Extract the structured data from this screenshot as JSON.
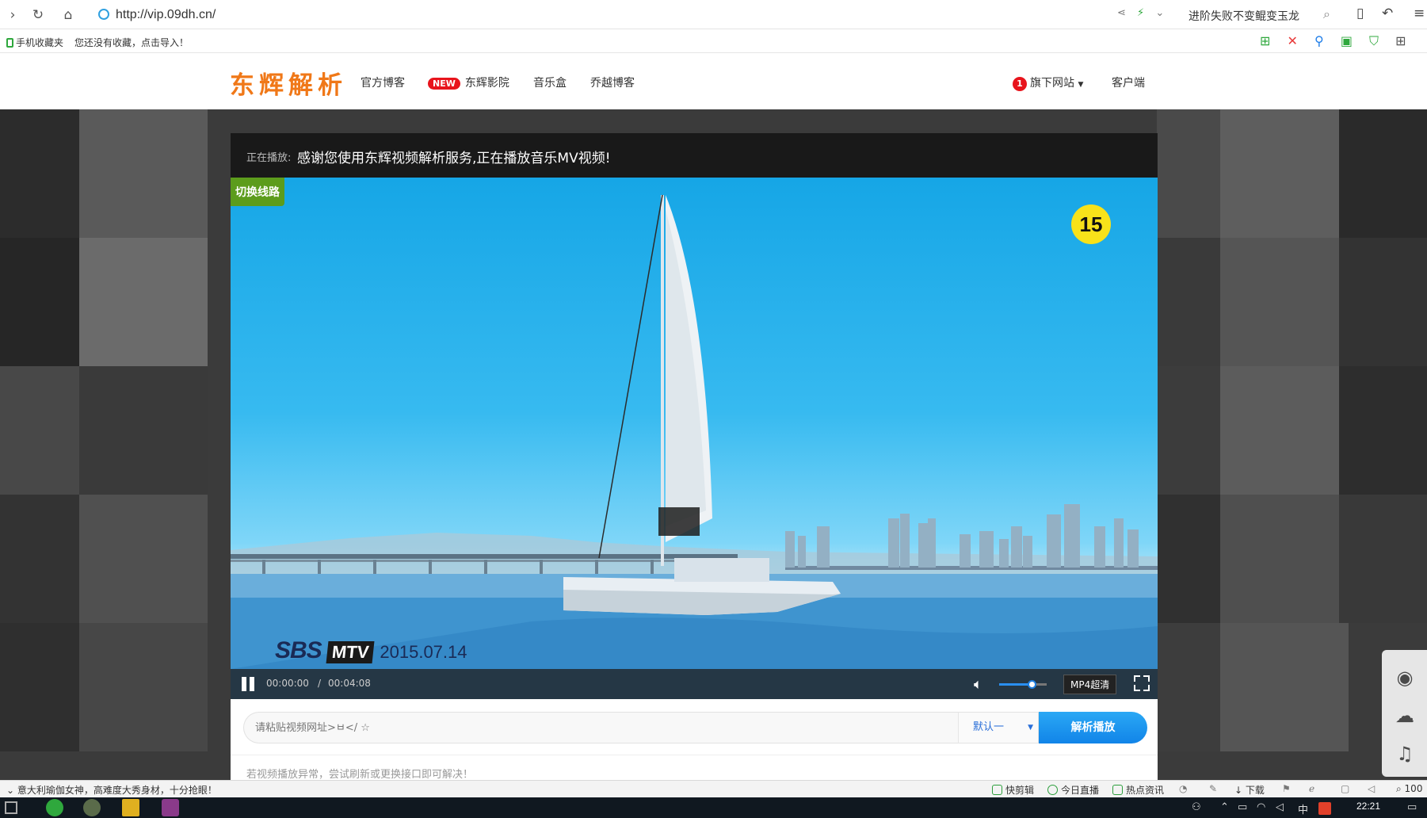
{
  "browser": {
    "url": "http://vip.09dh.cn/",
    "hot_search": "进阶失败不变鲲变玉龙",
    "favorites": {
      "mobile_fav": "手机收藏夹",
      "import_hint": "您还没有收藏，点击导入！"
    }
  },
  "site": {
    "logo": "东辉解析",
    "nav": {
      "blog": "官方博客",
      "new_badge": "NEW",
      "cinema": "东辉影院",
      "music_box": "音乐盒",
      "qiaoyue_blog": "乔越博客",
      "sites_badge": "1",
      "sites": "旗下网站",
      "client": "客户端"
    }
  },
  "player": {
    "now_playing_label": "正在播放:",
    "now_playing_text": "感谢您使用东辉视频解析服务,正在播放音乐MV视频!",
    "switch_line": "切换线路",
    "rating": "15",
    "watermark": {
      "sbs": "SBS",
      "mtv": "MTV",
      "date": "2015.07.14"
    },
    "time_current": "00:00:00",
    "time_separator": "/",
    "time_total": "00:04:08",
    "volume": 0.7,
    "quality": "MP4超清"
  },
  "parse": {
    "placeholder": "请粘贴视频网址>ㅂ</ ☆",
    "select_value": "默认一",
    "button": "解析播放",
    "tip": "若视频播放异常，尝试刷新或更换接口即可解决！"
  },
  "status_bar": {
    "news": "意大利瑜伽女神，高难度大秀身材，十分抢眼！",
    "quick_edit": "快剪辑",
    "live_today": "今日直播",
    "hot_news": "热点资讯",
    "download": "下载",
    "zoom": "100"
  },
  "taskbar": {
    "clock": "22:21",
    "ime": "中"
  },
  "colors": {
    "logo": "#f07818",
    "switch_line_bg": "#5c9c1c",
    "parse_button": "#1a96ee",
    "badge_red": "#e8141c"
  }
}
